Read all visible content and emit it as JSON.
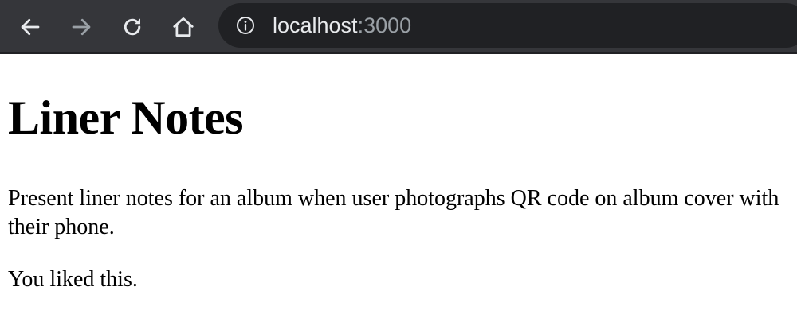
{
  "browser": {
    "url_host": "localhost",
    "url_port": ":3000",
    "icons": {
      "back": "arrow-left-icon",
      "forward": "arrow-right-icon",
      "reload": "reload-icon",
      "home": "home-icon",
      "site_info": "info-icon"
    },
    "colors": {
      "toolbar_bg": "#35363a",
      "omnibox_bg": "#202124",
      "icon_active": "#e8eaed",
      "icon_disabled": "#9aa0a6"
    }
  },
  "page": {
    "title": "Liner Notes",
    "description": "Present liner notes for an album when user photographs QR code on album cover with their phone.",
    "status": "You liked this."
  }
}
